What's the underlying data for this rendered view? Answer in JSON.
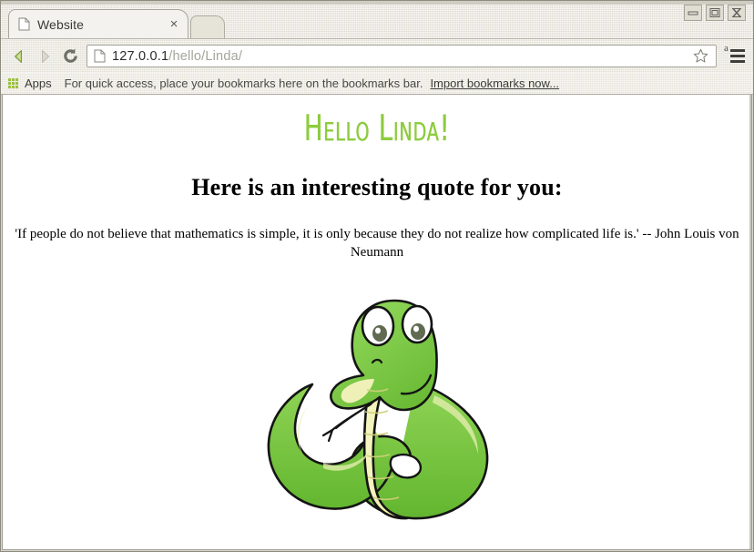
{
  "window": {
    "controls": [
      {
        "name": "minimize",
        "glyph": "minimize-icon"
      },
      {
        "name": "maximize",
        "glyph": "maximize-icon"
      },
      {
        "name": "close",
        "glyph": "close-icon"
      }
    ]
  },
  "browser": {
    "tab": {
      "title": "Website",
      "favicon": "page-icon",
      "close_label": "×"
    },
    "nav": {
      "back_label": "back-arrow-icon",
      "forward_label": "forward-arrow-icon",
      "reload_label": "reload-icon"
    },
    "omnibox": {
      "host": "127.0.0.1",
      "path": "/hello/Linda/",
      "full_url": "127.0.0.1/hello/Linda/",
      "page_icon": "page-icon",
      "star_icon": "star-icon"
    },
    "menu": {
      "superscript": "a",
      "icon": "hamburger-menu-icon"
    },
    "bookmarks": {
      "apps_label": "Apps",
      "apps_icon": "apps-grid-icon",
      "hint": "For quick access, place your bookmarks here on the bookmarks bar.",
      "import_link": "Import bookmarks now..."
    }
  },
  "page": {
    "greeting": "Hello Linda!",
    "subtitle": "Here is an interesting quote for you:",
    "quote": "'If people do not believe that mathematics is simple, it is only because they do not realize how complicated life is.' -- John Louis von Neumann",
    "image_alt": "cartoon-green-snake"
  },
  "colors": {
    "greeting_green": "#8dcc3f",
    "snake_body": "#7ec845",
    "snake_body_dark": "#5fb02f",
    "snake_belly": "#f0f0a8",
    "snake_outline": "#1a1a1a",
    "chrome_bg": "#e2dfd5",
    "page_bg": "#ffffff"
  }
}
